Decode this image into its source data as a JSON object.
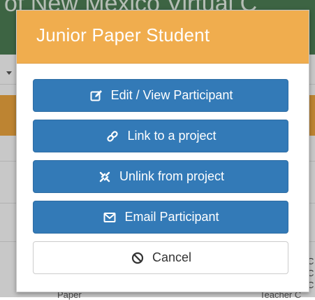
{
  "background": {
    "header_text": "of New Mexico Virtual C",
    "rows": [
      {
        "left": "Paper",
        "right": "Teacher C"
      }
    ],
    "right_letters": [
      "C",
      "C",
      "C"
    ]
  },
  "modal": {
    "title": "Junior Paper Student",
    "buttons": [
      {
        "label": "Edit / View Participant",
        "icon": "edit-icon",
        "style": "primary"
      },
      {
        "label": "Link to a project",
        "icon": "link-icon",
        "style": "primary"
      },
      {
        "label": "Unlink from project",
        "icon": "unlink-icon",
        "style": "primary"
      },
      {
        "label": "Email Participant",
        "icon": "envelope-icon",
        "style": "primary"
      },
      {
        "label": "Cancel",
        "icon": "ban-icon",
        "style": "default"
      }
    ]
  },
  "colors": {
    "header_bg": "#f0ad4e",
    "primary": "#337ab7",
    "page_header": "#4b7a52",
    "page_band": "#e7a23d"
  }
}
